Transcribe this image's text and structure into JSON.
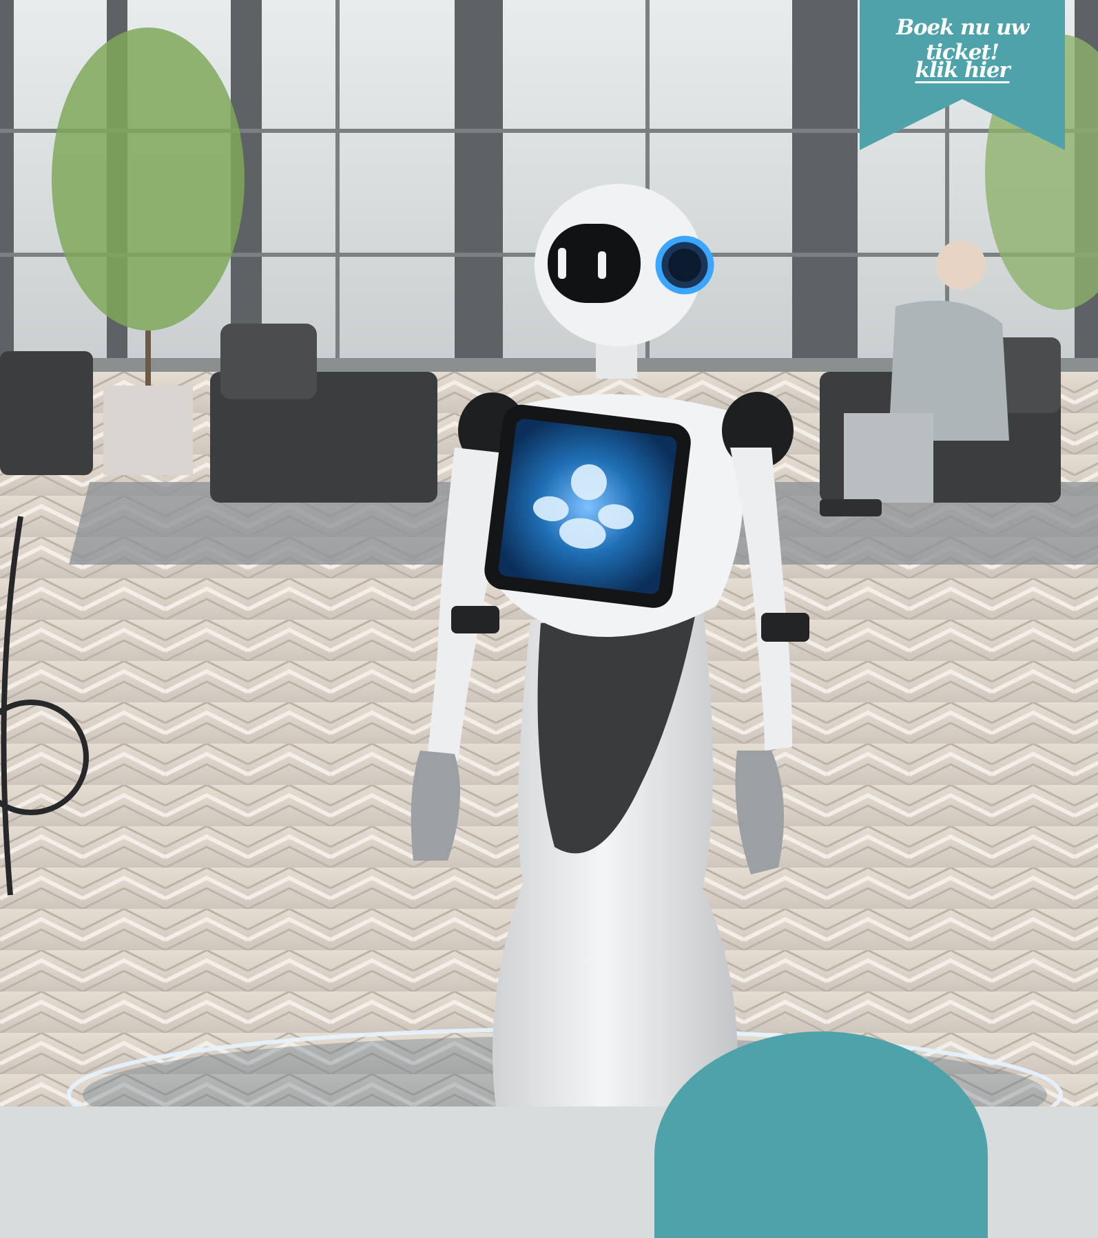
{
  "banner": {
    "title": "Boek nu uw ticket!",
    "link": "klik hier",
    "color": "#4ea2a9"
  },
  "scene": {
    "subject": "service-robot",
    "accent_color": "#4ea2a9",
    "screen_color": "#1f6fb5"
  }
}
